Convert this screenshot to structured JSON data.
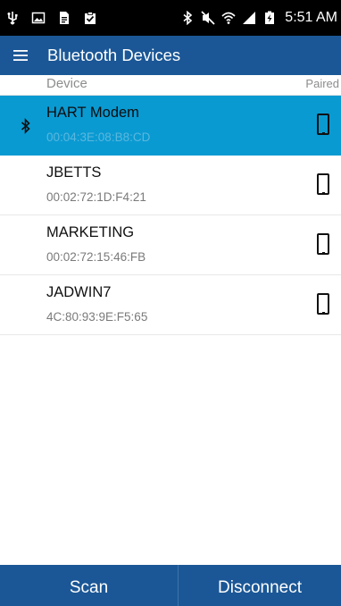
{
  "status_bar": {
    "time": "5:51 AM",
    "left_icons": [
      "usb-icon",
      "image-icon",
      "document-icon",
      "clipboard-check-icon"
    ],
    "right_icons": [
      "bluetooth-icon",
      "mute-icon",
      "wifi-icon",
      "signal-icon",
      "battery-icon"
    ]
  },
  "app_bar": {
    "menu_icon": "hamburger-menu-icon",
    "title": "Bluetooth Devices"
  },
  "list_header": {
    "device_label": "Device",
    "paired_label": "Paired"
  },
  "devices": [
    {
      "name": "HART Modem",
      "mac": "00:04:3E:08:B8:CD",
      "selected": true,
      "connected": true,
      "icon": "phone-icon"
    },
    {
      "name": "JBETTS",
      "mac": "00:02:72:1D:F4:21",
      "selected": false,
      "connected": false,
      "icon": "phone-icon"
    },
    {
      "name": "MARKETING",
      "mac": "00:02:72:15:46:FB",
      "selected": false,
      "connected": false,
      "icon": "phone-icon"
    },
    {
      "name": "JADWIN7",
      "mac": "4C:80:93:9E:F5:65",
      "selected": false,
      "connected": false,
      "icon": "phone-icon"
    }
  ],
  "bottom_bar": {
    "scan_label": "Scan",
    "disconnect_label": "Disconnect"
  },
  "colors": {
    "app_bar": "#1b5796",
    "selected_row": "#0a9ad2",
    "status_bar": "#000000"
  }
}
